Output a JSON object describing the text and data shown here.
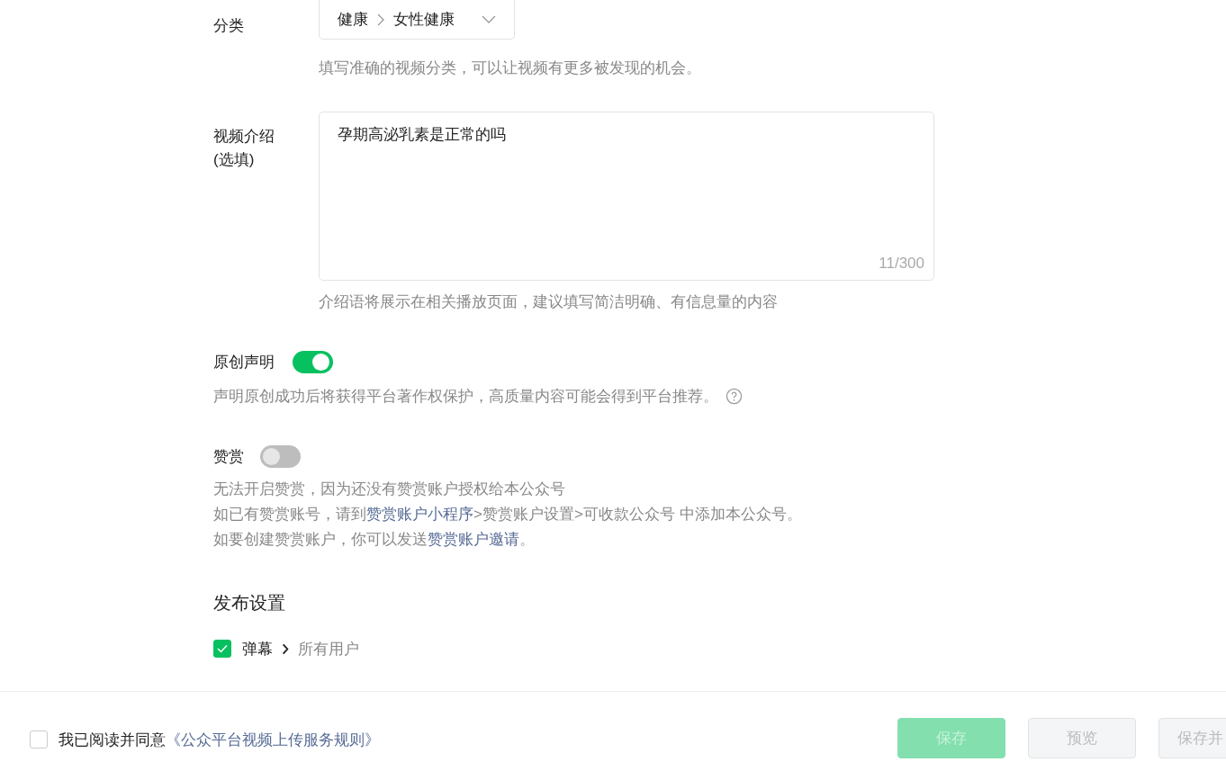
{
  "category": {
    "label": "分类",
    "path": [
      "健康",
      "女性健康"
    ],
    "hint": "填写准确的视频分类，可以让视频有更多被发现的机会。"
  },
  "description": {
    "label_lines": [
      "视频介绍",
      "(选填)"
    ],
    "value": "孕期高泌乳素是正常的吗",
    "counter": "11/300",
    "hint": "介绍语将展示在相关播放页面，建议填写简洁明确、有信息量的内容"
  },
  "original": {
    "label": "原创声明",
    "on": true,
    "hint": "声明原创成功后将获得平台著作权保护，高质量内容可能会得到平台推荐。"
  },
  "reward": {
    "label": "赞赏",
    "on": false,
    "lines": [
      [
        {
          "text": "无法开启赞赏，因为还没有赞赏账户授权给本公众号",
          "kind": "text"
        }
      ],
      [
        {
          "text": "如已有赞赏账号，请到",
          "kind": "text"
        },
        {
          "text": "赞赏账户小程序",
          "kind": "link"
        },
        {
          "text": ">赞赏账户设置>可收款公众号 中添加本公众号。",
          "kind": "text"
        }
      ],
      [
        {
          "text": "如要创建赞赏账户，你可以发送",
          "kind": "text"
        },
        {
          "text": "赞赏账户邀请",
          "kind": "link"
        },
        {
          "text": "。",
          "kind": "text"
        }
      ]
    ]
  },
  "publish": {
    "title": "发布设置",
    "items": [
      {
        "label": "弹幕",
        "checked": true,
        "value": "所有用户"
      }
    ]
  },
  "footer": {
    "agree_checked": false,
    "agree_text": "我已阅读并同意",
    "agree_link": "《公众平台视频上传服务规则》",
    "buttons": [
      {
        "label": "保存",
        "kind": "primary",
        "disabled": true
      },
      {
        "label": "预览",
        "kind": "default",
        "disabled": true
      },
      {
        "label": "保存并",
        "kind": "default",
        "disabled": true
      }
    ]
  }
}
